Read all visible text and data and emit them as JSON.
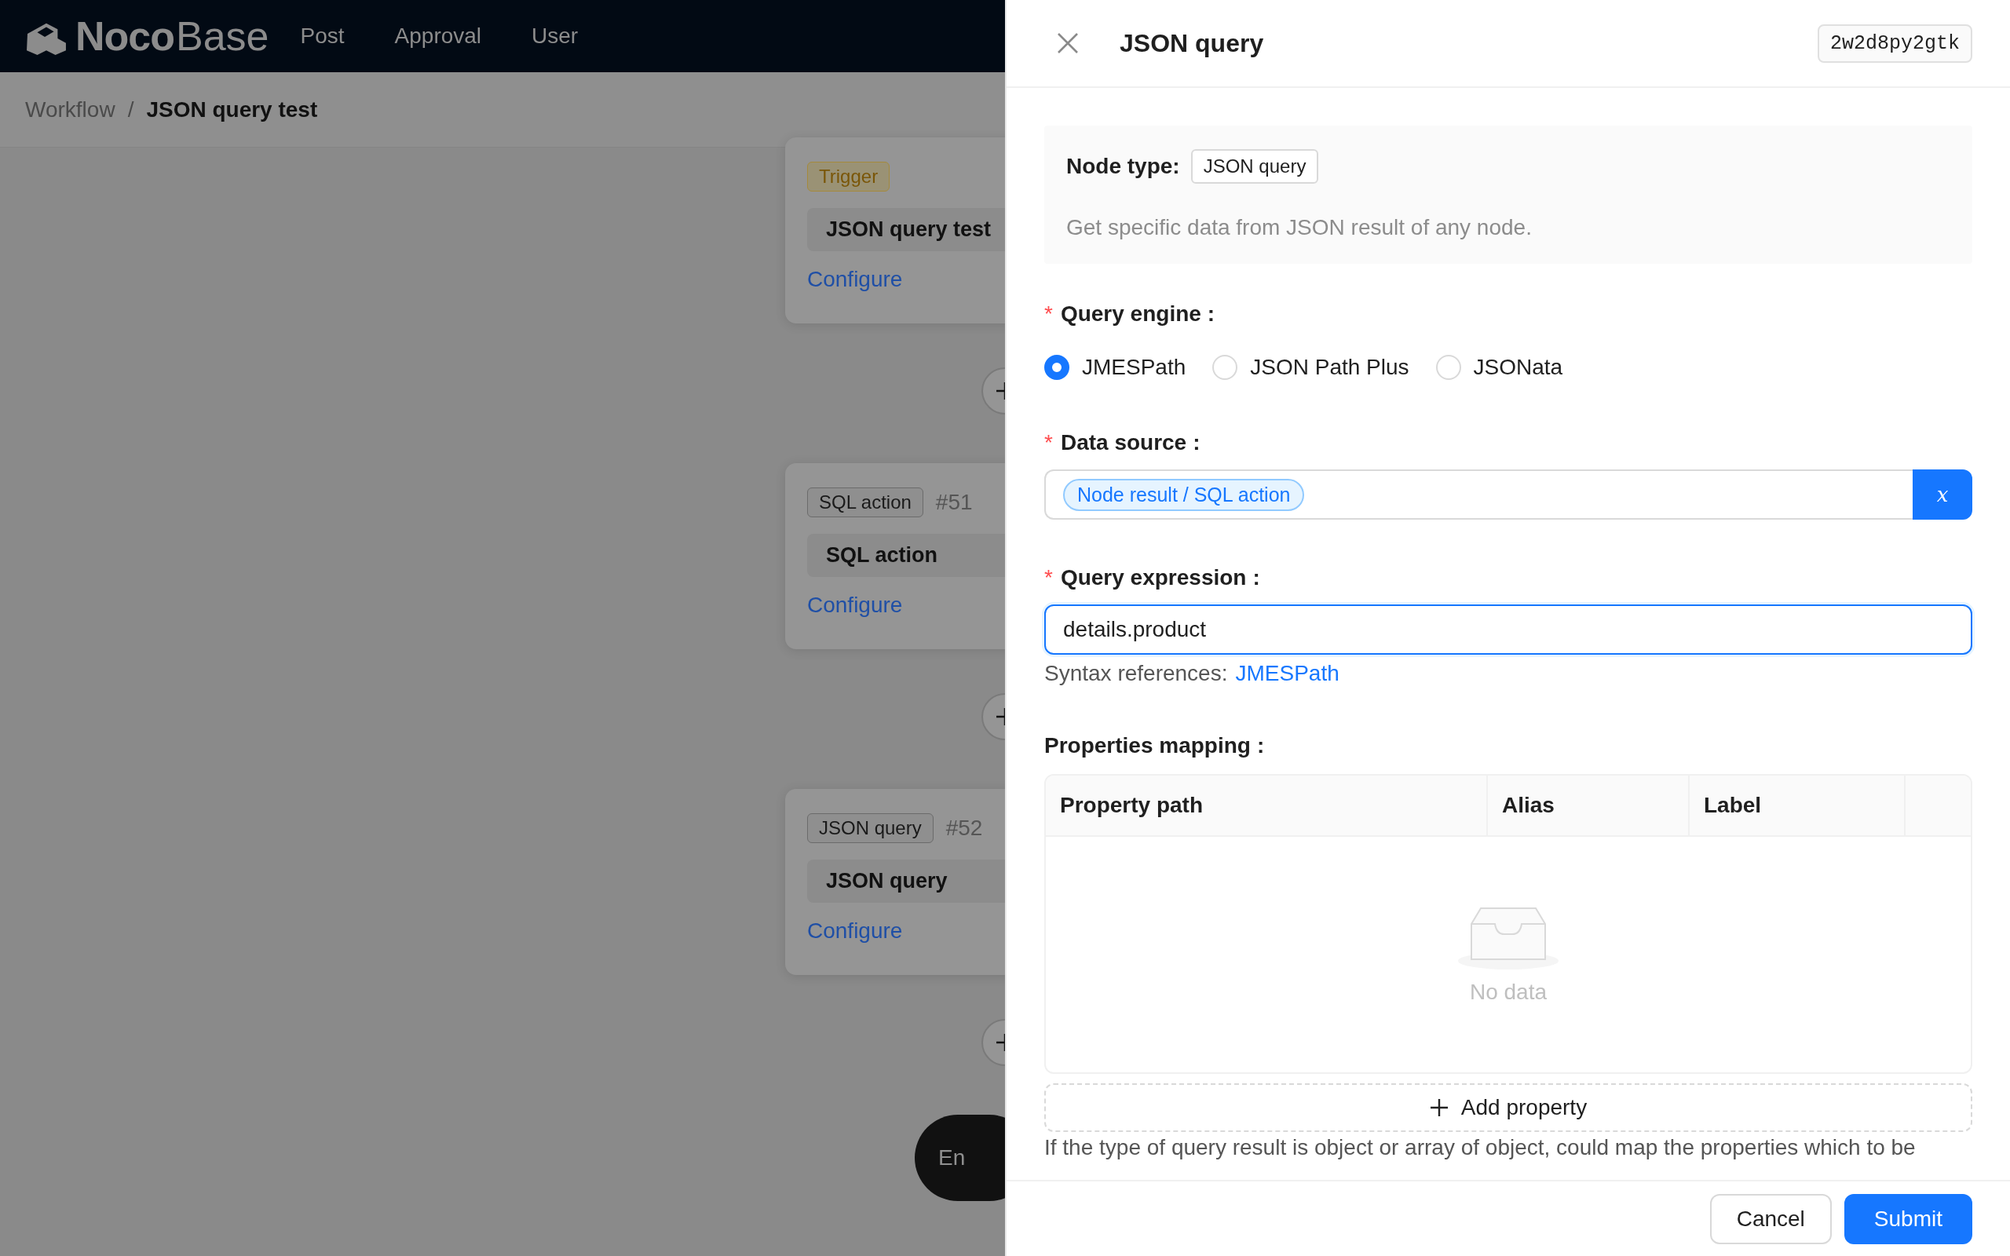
{
  "header": {
    "brand": {
      "bold": "Noco",
      "light": "Base"
    },
    "menu": [
      {
        "label": "Post",
        "selected": false
      },
      {
        "label": "Approval",
        "selected": false
      },
      {
        "label": "User",
        "selected": false
      }
    ]
  },
  "breadcrumb": {
    "items": [
      "Workflow",
      "JSON query test"
    ],
    "separator": "/"
  },
  "workflow": {
    "nodes": [
      {
        "kind": "trigger",
        "tag": "Trigger",
        "title": "JSON query test",
        "link": "Configure"
      },
      {
        "kind": "node",
        "tag": "SQL action",
        "id": "#51",
        "title": "SQL action",
        "link": "Configure"
      },
      {
        "kind": "node",
        "tag": "JSON query",
        "id": "#52",
        "title": "JSON query",
        "link": "Configure"
      }
    ],
    "end": "En"
  },
  "drawer": {
    "title": "JSON query",
    "key": "2w2d8py2gtk",
    "info": {
      "label": "Node type:",
      "type": "JSON query",
      "description": "Get specific data from JSON result of any node."
    },
    "fields": [
      {
        "kind": "radio",
        "label": "Query engine",
        "required_mark": "*",
        "colon": ":",
        "options": [
          {
            "label": "JMESPath",
            "selected": true
          },
          {
            "label": "JSON Path Plus",
            "selected": false
          },
          {
            "label": "JSONata",
            "selected": false
          }
        ]
      },
      {
        "kind": "variable",
        "label": "Data source",
        "required_mark": "*",
        "colon": ":",
        "value": "Node result / SQL action",
        "button": "x"
      },
      {
        "kind": "input",
        "label": "Query expression",
        "required_mark": "*",
        "colon": ":",
        "value": "details.product",
        "help": "Syntax references:",
        "help_link": "JMESPath"
      },
      {
        "kind": "table",
        "label": "Properties mapping",
        "colon": ":",
        "columns": [
          "Property path",
          "Alias",
          "Label"
        ],
        "empty": "No data",
        "add": "Add property",
        "help": "If the type of query result is object or array of object, could map the properties which to be"
      }
    ],
    "buttons": [
      {
        "label": "Cancel",
        "kind": "default"
      },
      {
        "label": "Submit",
        "kind": "primary"
      }
    ]
  }
}
